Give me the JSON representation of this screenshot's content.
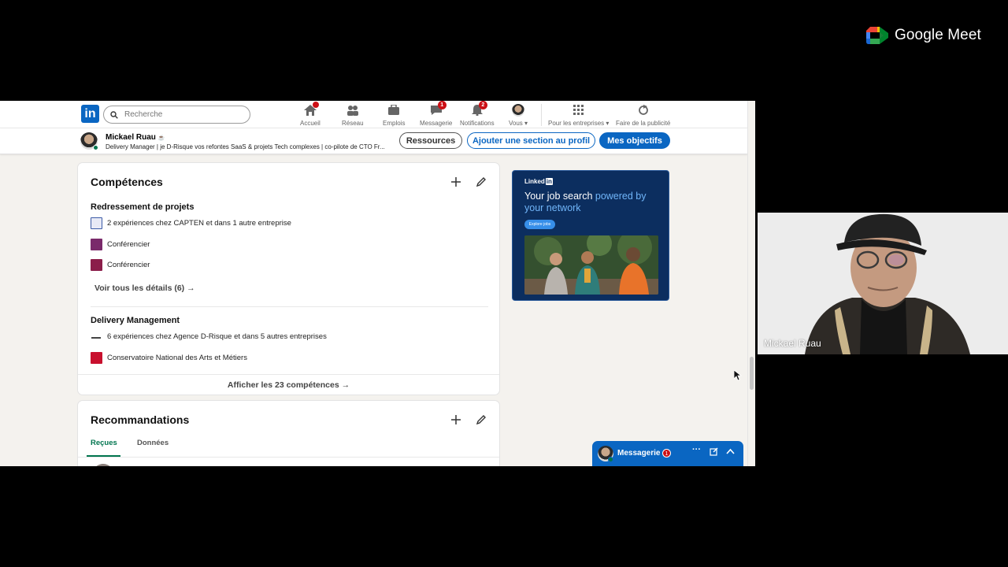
{
  "meet": {
    "brand": "Google Meet",
    "participant_name": "Mickael Ruau"
  },
  "nav": {
    "search_placeholder": "Recherche",
    "logo": "in",
    "items": [
      {
        "label": "Accueil",
        "icon": "home-icon",
        "badge": ""
      },
      {
        "label": "Réseau",
        "icon": "network-icon",
        "badge": ""
      },
      {
        "label": "Emplois",
        "icon": "briefcase-icon",
        "badge": ""
      },
      {
        "label": "Messagerie",
        "icon": "chat-icon",
        "badge": "1"
      },
      {
        "label": "Notifications",
        "icon": "bell-icon",
        "badge": "2"
      },
      {
        "label": "Vous ▾",
        "icon": "avatar",
        "badge": ""
      },
      {
        "label": "Pour les entreprises ▾",
        "icon": "grid-icon",
        "badge": ""
      },
      {
        "label": "Faire de la publicité",
        "icon": "ads-icon",
        "badge": ""
      }
    ]
  },
  "profile_bar": {
    "name": "Mickael Ruau",
    "name_icon": "☕",
    "headline": "Delivery Manager | je D-Risque vos refontes SaaS & projets Tech complexes | co-pilote de CTO Fr...",
    "btn_resources": "Ressources",
    "btn_add_section": "Ajouter une section au profil",
    "btn_goals": "Mes objectifs"
  },
  "skills": {
    "title": "Compétences",
    "groups": [
      {
        "name": "Redressement de projets",
        "lines": [
          {
            "text": "2 expériences chez CAPTEN et dans 1 autre entreprise",
            "logo_color": "#3b5aa6"
          },
          {
            "text": "Conférencier",
            "logo_color": "#7a2a6b"
          },
          {
            "text": "Conférencier",
            "logo_color": "#8b1e4a"
          }
        ],
        "see_all": "Voir tous les détails (6) →"
      },
      {
        "name": "Delivery Management",
        "lines": [
          {
            "text": "6 expériences chez Agence D-Risque et dans 5 autres entreprises",
            "logo_color": "#333333"
          },
          {
            "text": "Conservatoire National des Arts et Métiers",
            "logo_color": "#c8102e"
          }
        ]
      }
    ],
    "show_all": "Afficher les 23 compétences →"
  },
  "recommendations": {
    "title": "Recommandations",
    "tab_received": "Reçues",
    "tab_given": "Données"
  },
  "ad": {
    "brand": "Linked",
    "brand_suffix": "in",
    "headline_plain": "Your job search ",
    "headline_highlight": "powered by your network",
    "cta": "Explore jobs"
  },
  "messaging": {
    "label": "Messagerie",
    "badge": "1"
  },
  "colors": {
    "linkedin_blue": "#0a66c2",
    "green": "#01754f",
    "badge_red": "#cc1016"
  }
}
